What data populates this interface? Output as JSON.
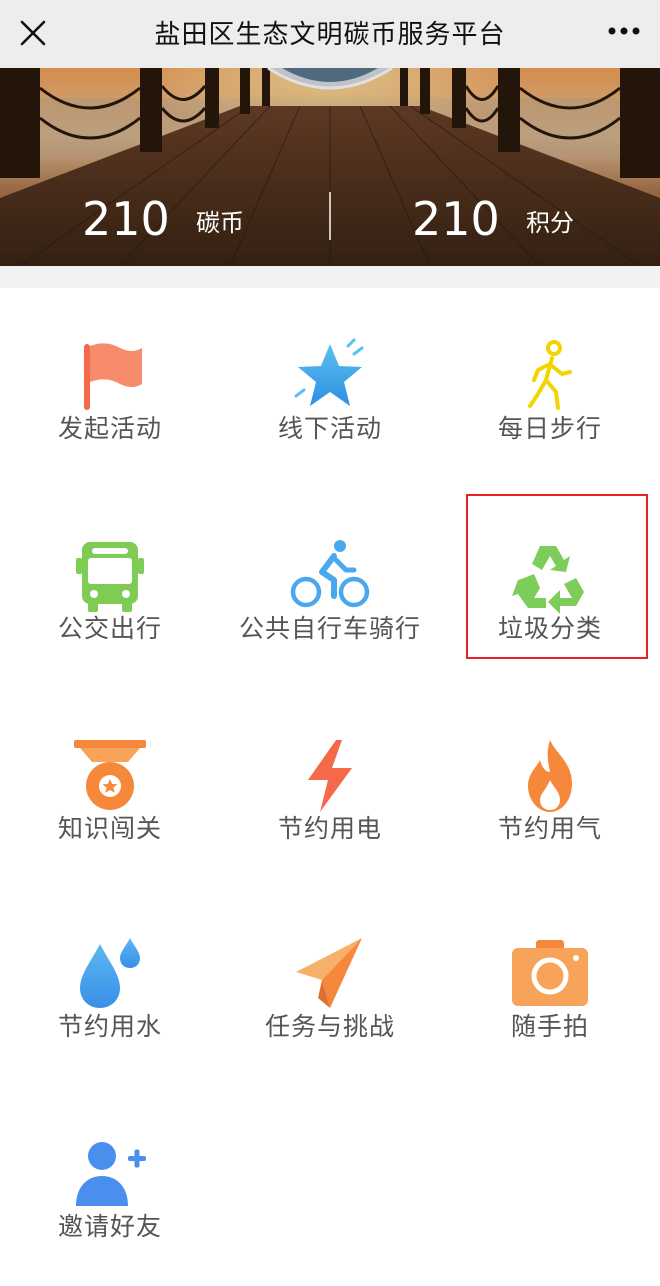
{
  "header": {
    "title": "盐田区生态文明碳币服务平台",
    "close_icon": "close-icon",
    "more_icon": "more-options-icon"
  },
  "banner": {
    "carbon_coins": {
      "value": "210",
      "unit": "碳币"
    },
    "points": {
      "value": "210",
      "unit": "积分"
    }
  },
  "menu": [
    {
      "label": "发起活动",
      "icon": "flag-icon",
      "color": "#f4694a"
    },
    {
      "label": "线下活动",
      "icon": "star-icon",
      "color": "#3aa6e8"
    },
    {
      "label": "每日步行",
      "icon": "walking-person-icon",
      "color": "#f2d500"
    },
    {
      "label": "公交出行",
      "icon": "bus-icon",
      "color": "#7fcc54"
    },
    {
      "label": "公共自行车骑行",
      "icon": "cyclist-icon",
      "color": "#4aa8ee"
    },
    {
      "label": "垃圾分类",
      "icon": "recycle-icon",
      "color": "#7ccd5a",
      "highlighted": true
    },
    {
      "label": "知识闯关",
      "icon": "medal-icon",
      "color": "#f5883a"
    },
    {
      "label": "节约用电",
      "icon": "lightning-icon",
      "color": "#f4694a"
    },
    {
      "label": "节约用气",
      "icon": "flame-icon",
      "color": "#f5883a"
    },
    {
      "label": "节约用水",
      "icon": "water-drop-icon",
      "color": "#4aa8ee"
    },
    {
      "label": "任务与挑战",
      "icon": "paper-plane-icon",
      "color": "#f5a050"
    },
    {
      "label": "随手拍",
      "icon": "camera-icon",
      "color": "#f5883a"
    },
    {
      "label": "邀请好友",
      "icon": "add-user-icon",
      "color": "#4a8eee"
    }
  ]
}
